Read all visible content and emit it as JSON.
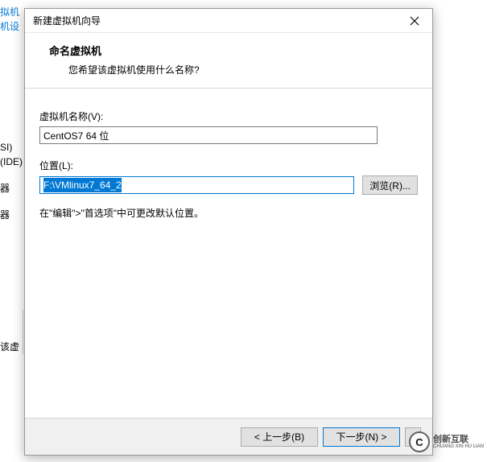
{
  "background_fragments": {
    "f1": "拟机",
    "f2": "机设",
    "f3": "SI)",
    "f4": "(IDE)",
    "f5": "器",
    "f6": "器",
    "f7": "该虚"
  },
  "dialog": {
    "title": "新建虚拟机向导",
    "header_title": "命名虚拟机",
    "header_sub": "您希望该虚拟机使用什么名称?",
    "vm_name_label": "虚拟机名称(V):",
    "vm_name_value": "CentOS7 64 位",
    "location_label": "位置(L):",
    "location_value": "F:\\VMlinux7_64_2",
    "browse_label": "浏览(R)...",
    "hint": "在\"编辑\">\"首选项\"中可更改默认位置。",
    "back_label": "< 上一步(B)",
    "next_label": "下一步(N) >",
    "cancel_label": ""
  },
  "watermark": {
    "brand": "创新互联",
    "sub": "CHUANG XIN HU LIAN"
  }
}
